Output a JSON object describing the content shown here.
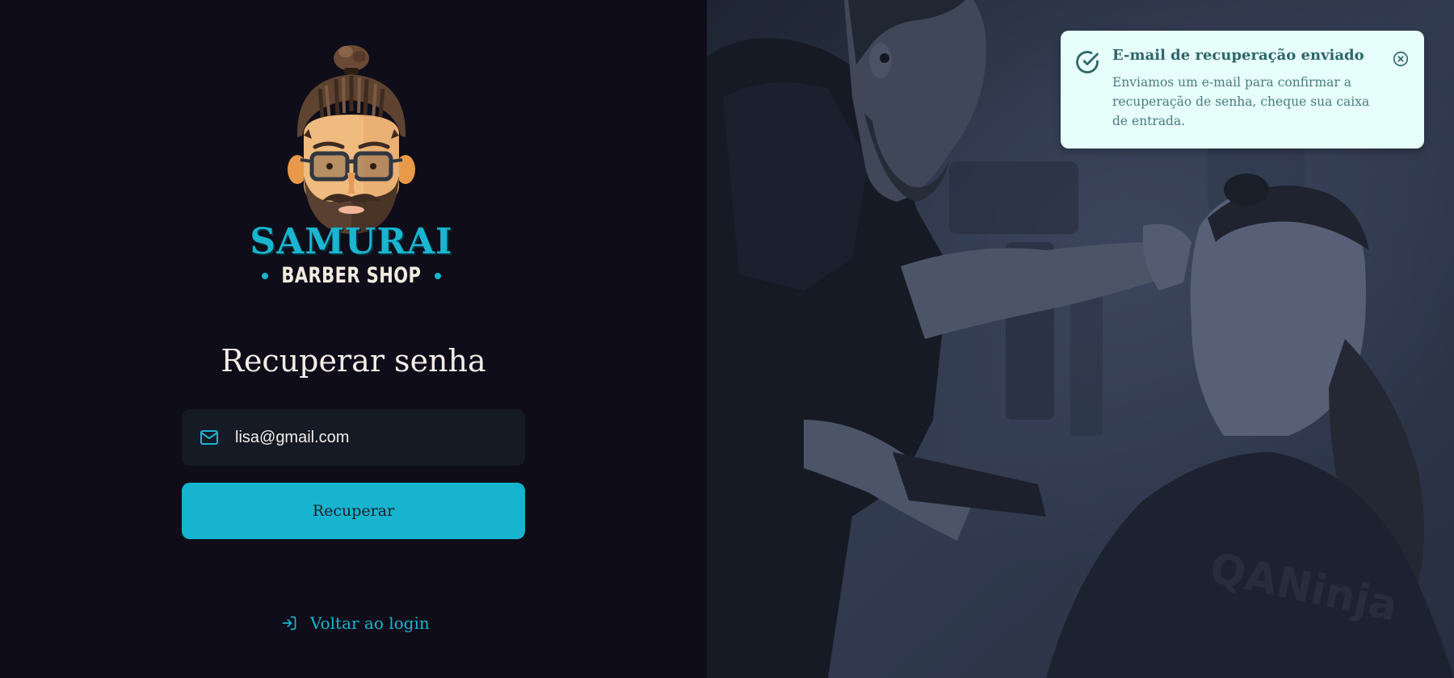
{
  "brand": {
    "name": "SAMURAI",
    "tagline": "BARBER SHOP",
    "logo_icon": "bearded-barber-mascot-logo"
  },
  "form": {
    "title": "Recuperar senha",
    "email": {
      "value": "lisa@gmail.com",
      "placeholder": "E-mail",
      "icon": "mail-icon"
    },
    "submit_label": "Recuperar",
    "back_link_label": "Voltar ao login",
    "back_link_icon": "log-in-icon"
  },
  "toast": {
    "type": "success",
    "title": "E-mail de recuperação enviado",
    "message": "Enviamos um e-mail para confirmar a recuperação de senha, cheque sua caixa de entrada.",
    "icon": "check-circle-icon",
    "close_icon": "x-circle-icon"
  },
  "colors": {
    "background": "#0e0d19",
    "accent": "#1ab5d0",
    "input_background": "#151a24",
    "text": "#f4ede8",
    "toast_background": "#e6fffa",
    "toast_text": "#2e656a"
  }
}
